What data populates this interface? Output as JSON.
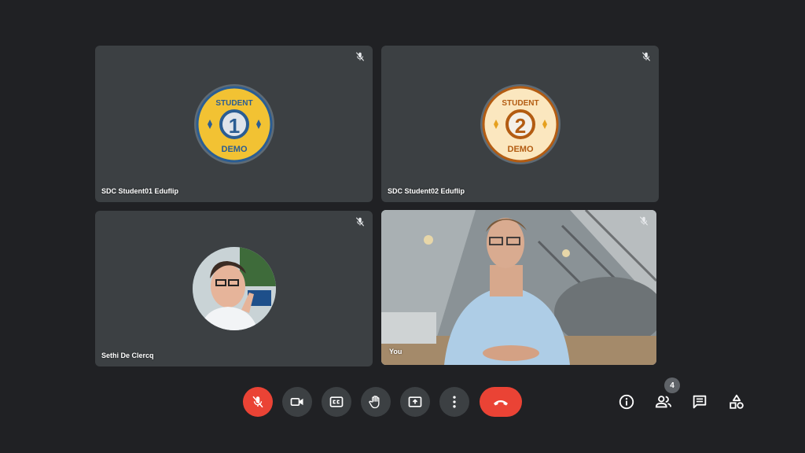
{
  "participants": [
    {
      "name": "SDC Student01 Eduflip",
      "badge_top": "STUDENT",
      "badge_number": "1",
      "badge_bottom": "DEMO",
      "badge_color": "#f2c233",
      "ring_color": "#2a5d93"
    },
    {
      "name": "SDC Student02 Eduflip",
      "badge_top": "STUDENT",
      "badge_number": "2",
      "badge_bottom": "DEMO",
      "badge_color": "#fbe7bf",
      "ring_color": "#b35c12"
    },
    {
      "name": "Sethi De Clercq"
    },
    {
      "name": "You"
    }
  ],
  "controls": {
    "mic": "mic-off-icon",
    "camera": "camera-icon",
    "captions": "closed-captions-icon",
    "raise_hand": "hand-icon",
    "present": "present-screen-icon",
    "more": "more-options-icon",
    "leave": "hang-up-icon"
  },
  "right_controls": {
    "people_count": "4"
  },
  "colors": {
    "background": "#202124",
    "tile": "#3c4043",
    "danger": "#ea4335"
  }
}
